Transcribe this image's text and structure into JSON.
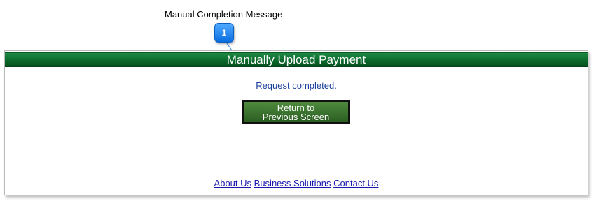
{
  "callout": {
    "title": "Manual Completion Message",
    "badge_number": "1"
  },
  "panel": {
    "title": "Manually Upload Payment",
    "status_message": "Request completed.",
    "return_button": {
      "line1": "Return to",
      "line2": "Previous Screen"
    }
  },
  "footer": {
    "links": [
      "About Us",
      "Business Solutions",
      "Contact Us"
    ]
  },
  "colors": {
    "header_green": "#0b6a2c",
    "button_green": "#3b7030",
    "status_blue": "#1a3f9c",
    "link_blue": "#1a1ab0",
    "badge_blue": "#1a82f0"
  }
}
